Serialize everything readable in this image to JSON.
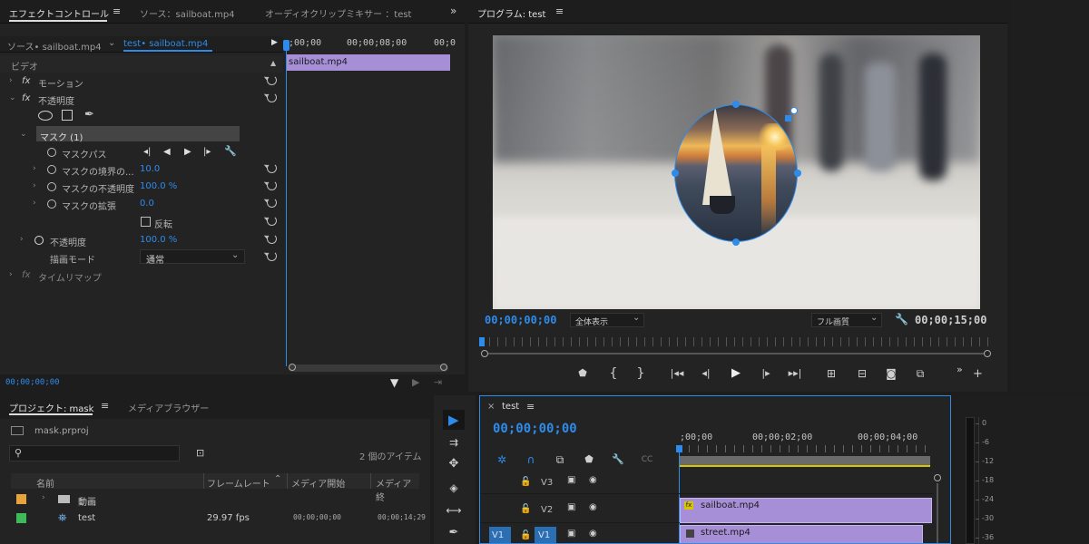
{
  "effect_panel": {
    "tabs": [
      {
        "label": "エフェクトコントロール"
      },
      {
        "label": "ソース：sailboat.mp4"
      },
      {
        "label": "オーディオクリップミキサー ：test"
      }
    ],
    "source_crumb": "ソース• sailboat.mp4",
    "seq_crumb": "test• sailboat.mp4",
    "ruler": {
      "t0": ";00;00",
      "t1": "00;00;08;00",
      "t2": "00;0"
    },
    "clip_label": "sailboat.mp4",
    "section_video": "ビデオ",
    "motion": "モーション",
    "opacity": "不透明度",
    "mask": "マスク (1)",
    "mask_path": "マスクパス",
    "mask_feather": "マスクの境界の...",
    "mask_feather_val": "10.0",
    "mask_opacity": "マスクの不透明度",
    "mask_opacity_val": "100.0 %",
    "mask_expand": "マスクの拡張",
    "mask_expand_val": "0.0",
    "invert": "反転",
    "opacity_row": "不透明度",
    "opacity_val": "100.0 %",
    "blend_mode": "描画モード",
    "blend_val": "通常",
    "time_remap": "タイムリマップ",
    "fx": "fx",
    "timecode": "00;00;00;00"
  },
  "program_panel": {
    "title": "プログラム: test",
    "timecode_left": "00;00;00;00",
    "zoom": "全体表示",
    "quality": "フル画質",
    "timecode_right": "00;00;15;00"
  },
  "project_panel": {
    "tab": "プロジェクト: mask",
    "tab2": "メディアブラウザー",
    "file": "mask.prproj",
    "item_count": "2 個のアイテム",
    "columns": [
      "名前",
      "フレームレート",
      "メディア開始",
      "メディア終"
    ],
    "rows": [
      {
        "name": "動画",
        "fps": "",
        "start": "",
        "end": "",
        "color": "#e8a33c"
      },
      {
        "name": "test",
        "fps": "29.97 fps",
        "start": "00;00;00;00",
        "end": "00;00;14;29",
        "color": "#3dbb5b"
      }
    ]
  },
  "timeline_panel": {
    "tab": "test",
    "timecode": "00;00;00;00",
    "ruler": {
      "t0": ";00;00",
      "t1": "00;00;02;00",
      "t2": "00;00;04;00"
    },
    "tracks": [
      {
        "label": "V3"
      },
      {
        "label": "V2",
        "clip": "sailboat.mp4"
      },
      {
        "label": "V1",
        "clip": "street.mp4",
        "src": "V1"
      }
    ]
  },
  "meter": {
    "labels": [
      "0",
      "-6",
      "-12",
      "-18",
      "-24",
      "-30",
      "-36"
    ]
  },
  "colors": {
    "accent": "#2d8ceb",
    "clip": "#a78fd8",
    "bg": "#232323"
  }
}
